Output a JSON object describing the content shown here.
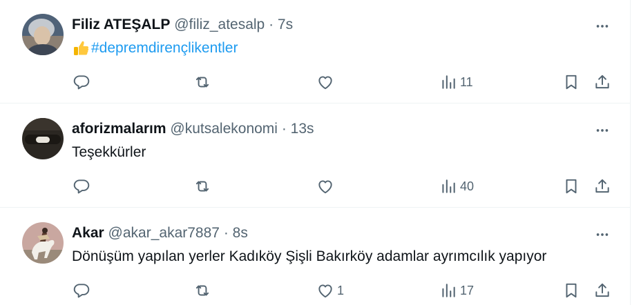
{
  "tweets": [
    {
      "name": "Filiz ATEŞALP",
      "handle": "@filiz_atesalp",
      "separator": "·",
      "time": "7s",
      "emoji": "👍",
      "text": "#depremdirençlikentler",
      "is_hashtag": true,
      "stats": {
        "replies": "",
        "retweets": "",
        "likes": "",
        "views": "11"
      },
      "avatar_colors": {
        "bg": "#5d6d80",
        "face": "#d9c2a9",
        "hair": "#bfc5cc"
      }
    },
    {
      "name": "aforizmalarım",
      "handle": "@kutsalekonomi",
      "separator": "·",
      "time": "13s",
      "text": "Teşekkürler",
      "is_hashtag": false,
      "stats": {
        "replies": "",
        "retweets": "",
        "likes": "",
        "views": "40"
      },
      "avatar_colors": {
        "bg": "#2b2722",
        "object": "#e8e4dc"
      }
    },
    {
      "name": "Akar",
      "handle": "@akar_akar7887",
      "separator": "·",
      "time": "8s",
      "text": "Dönüşüm yapılan yerler Kadıköy Şişli Bakırköy adamlar ayrımcılık yapıyor",
      "is_hashtag": false,
      "stats": {
        "replies": "",
        "retweets": "",
        "likes": "1",
        "views": "17"
      },
      "avatar_colors": {
        "bg": "#c9a7a0",
        "horse": "#f2efe9",
        "rider": "#5a3a2c"
      }
    }
  ],
  "icons": {
    "more": "more-icon",
    "reply": "reply-icon",
    "retweet": "retweet-icon",
    "like": "like-icon",
    "views": "views-icon",
    "bookmark": "bookmark-icon",
    "share": "share-icon"
  },
  "colors": {
    "text": "#0f1419",
    "secondary": "#536471",
    "link": "#1d9bf0",
    "divider": "#eff3f4"
  }
}
